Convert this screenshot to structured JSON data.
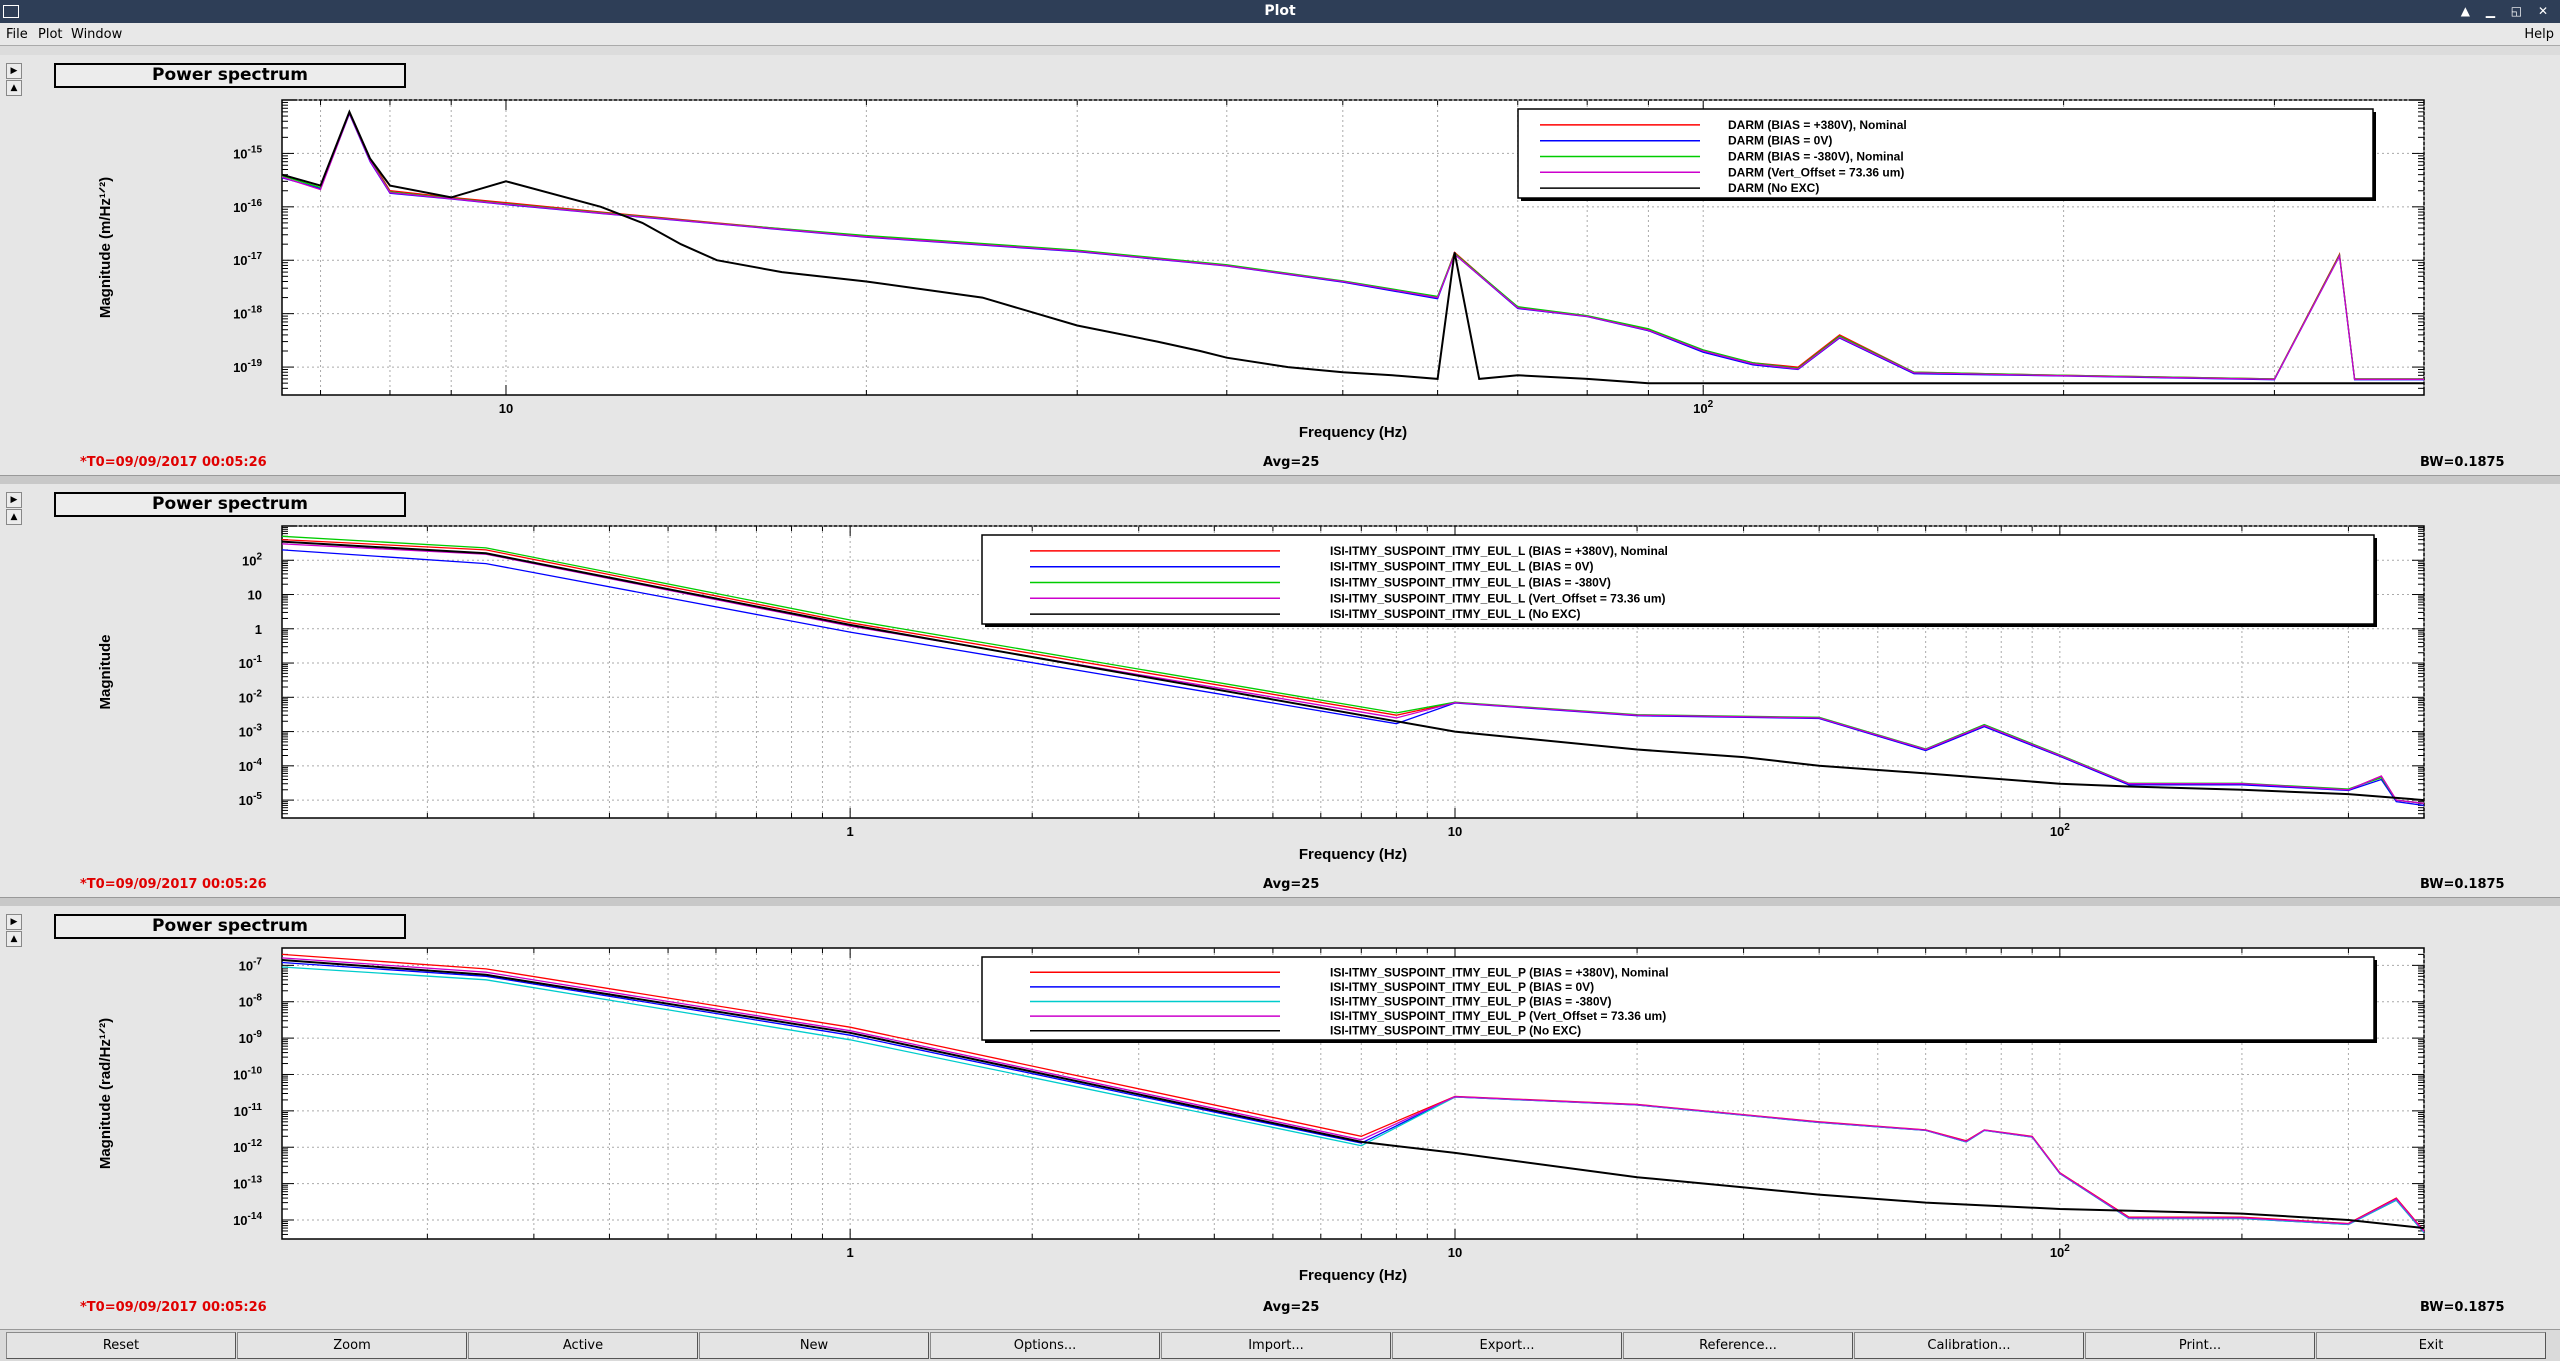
{
  "window": {
    "title": "Plot"
  },
  "menu": {
    "items": [
      "File",
      "Plot",
      "Window"
    ],
    "help": "Help"
  },
  "panels": [
    {
      "title": "Power spectrum",
      "t0": "*T0=09/09/2017 00:05:26",
      "avg": "Avg=25",
      "bw": "BW=0.1875"
    },
    {
      "title": "Power spectrum",
      "t0": "*T0=09/09/2017 00:05:26",
      "avg": "Avg=25",
      "bw": "BW=0.1875"
    },
    {
      "title": "Power spectrum",
      "t0": "*T0=09/09/2017 00:05:26",
      "avg": "Avg=25",
      "bw": "BW=0.1875"
    }
  ],
  "toolbar": {
    "buttons": [
      "Reset",
      "Zoom",
      "Active",
      "New",
      "Options...",
      "Import...",
      "Export...",
      "Reference...",
      "Calibration...",
      "Print...",
      "Exit"
    ]
  },
  "chart_data": [
    {
      "type": "line",
      "log_x": true,
      "log_y": true,
      "xlabel": "Frequency (Hz)",
      "ylabel": "Magnitude (m/Hz^1/2)",
      "xlim": [
        6.5,
        400
      ],
      "ylim": [
        3e-20,
        1e-14
      ],
      "xticks": [
        {
          "v": 10,
          "t": "10"
        },
        {
          "v": 100,
          "t": "10^2"
        }
      ],
      "yticks": [
        {
          "v": 1e-19,
          "t": "10^-19"
        },
        {
          "v": 1e-18,
          "t": "10^-18"
        },
        {
          "v": 1e-17,
          "t": "10^-17"
        },
        {
          "v": 1e-16,
          "t": "10^-16"
        },
        {
          "v": 1e-15,
          "t": "10^-15"
        }
      ],
      "legend_position": "top-right",
      "series": [
        {
          "name": "DARM (BIAS = +380V), Nominal",
          "color": "#ff0000",
          "x": [
            6.5,
            7,
            7.4,
            7.7,
            8,
            9,
            10,
            12,
            15,
            20,
            30,
            40,
            50,
            60,
            62,
            70,
            80,
            90,
            100,
            110,
            120,
            130,
            150,
            200,
            300,
            340,
            350,
            360,
            400
          ],
          "y": [
            4e-16,
            2.5e-16,
            6e-15,
            8e-16,
            2e-16,
            1.5e-16,
            1.2e-16,
            8e-17,
            5e-17,
            2.8e-17,
            1.5e-17,
            8e-18,
            4e-18,
            2e-18,
            1.4e-17,
            1.3e-18,
            9e-19,
            5e-19,
            2e-19,
            1.2e-19,
            1e-19,
            4e-19,
            8e-20,
            7e-20,
            6e-20,
            1.3e-17,
            6e-20,
            6e-20,
            6e-20
          ]
        },
        {
          "name": "DARM (BIAS = 0V)",
          "color": "#0000ff",
          "x": [
            6.5,
            7,
            7.4,
            7.7,
            8,
            9,
            10,
            12,
            15,
            20,
            30,
            40,
            50,
            60,
            62,
            70,
            80,
            90,
            100,
            110,
            120,
            130,
            150,
            200,
            300,
            340,
            350,
            360,
            400
          ],
          "y": [
            3.5e-16,
            2.2e-16,
            5.5e-15,
            7e-16,
            1.8e-16,
            1.4e-16,
            1.1e-16,
            7.5e-17,
            4.8e-17,
            2.7e-17,
            1.45e-17,
            7.8e-18,
            3.9e-18,
            1.9e-18,
            1.3e-17,
            1.25e-18,
            8.8e-19,
            4.8e-19,
            1.9e-19,
            1.1e-19,
            9e-20,
            3.5e-19,
            7.5e-20,
            6.8e-20,
            5.8e-20,
            1.2e-17,
            5.8e-20,
            5.8e-20,
            5.8e-20
          ]
        },
        {
          "name": "DARM (BIAS = -380V), Nominal",
          "color": "#00cc00",
          "x": [
            6.5,
            7,
            7.4,
            7.7,
            8,
            9,
            10,
            12,
            15,
            20,
            30,
            40,
            50,
            60,
            62,
            70,
            80,
            90,
            100,
            110,
            120,
            130,
            150,
            200,
            300,
            340,
            350,
            360,
            400
          ],
          "y": [
            3.8e-16,
            2.3e-16,
            5.8e-15,
            7.5e-16,
            1.9e-16,
            1.45e-16,
            1.15e-16,
            7.8e-17,
            4.9e-17,
            2.9e-17,
            1.55e-17,
            8.2e-18,
            4.1e-18,
            2.1e-18,
            1.35e-17,
            1.35e-18,
            9.2e-19,
            5.2e-19,
            2.1e-19,
            1.2e-19,
            9.5e-20,
            3.8e-19,
            8e-20,
            7e-20,
            6e-20,
            1.25e-17,
            6e-20,
            6e-20,
            6e-20
          ]
        },
        {
          "name": "DARM (Vert_Offset = 73.36 um)",
          "color": "#cc00cc",
          "x": [
            6.5,
            7,
            7.4,
            7.7,
            8,
            9,
            10,
            12,
            15,
            20,
            30,
            40,
            50,
            60,
            62,
            70,
            80,
            90,
            100,
            110,
            120,
            130,
            150,
            200,
            300,
            340,
            350,
            360,
            400
          ],
          "y": [
            3.6e-16,
            2.1e-16,
            5.6e-15,
            7.2e-16,
            1.85e-16,
            1.42e-16,
            1.12e-16,
            7.6e-17,
            4.85e-17,
            2.75e-17,
            1.48e-17,
            7.9e-18,
            4e-18,
            2e-18,
            1.3e-17,
            1.28e-18,
            8.9e-19,
            4.9e-19,
            2e-19,
            1.15e-19,
            9.2e-20,
            3.6e-19,
            7.8e-20,
            6.9e-20,
            5.9e-20,
            1.2e-17,
            5.9e-20,
            5.9e-20,
            5.9e-20
          ]
        },
        {
          "name": "DARM (No EXC)",
          "color": "#000000",
          "x": [
            6.5,
            7,
            7.4,
            7.7,
            8,
            9,
            10,
            12,
            13,
            14,
            15,
            17,
            20,
            25,
            30,
            35,
            38,
            40,
            45,
            50,
            55,
            60,
            62,
            65,
            70,
            80,
            90,
            100,
            150,
            200,
            300,
            400
          ],
          "y": [
            4e-16,
            2.5e-16,
            6e-15,
            8e-16,
            2.5e-16,
            1.5e-16,
            3e-16,
            1e-16,
            5e-17,
            2e-17,
            1e-17,
            6e-18,
            4e-18,
            2e-18,
            6e-19,
            3e-19,
            2e-19,
            1.5e-19,
            1e-19,
            8e-20,
            7e-20,
            6e-20,
            1.4e-17,
            6e-20,
            7e-20,
            6e-20,
            5e-20,
            5e-20,
            5e-20,
            5e-20,
            5e-20,
            5e-20
          ]
        }
      ]
    },
    {
      "type": "line",
      "log_x": true,
      "log_y": true,
      "xlabel": "Frequency (Hz)",
      "ylabel": "Magnitude",
      "xlim": [
        0.115,
        400
      ],
      "ylim": [
        3e-06,
        1000
      ],
      "xticks": [
        {
          "v": 1,
          "t": "1"
        },
        {
          "v": 10,
          "t": "10"
        },
        {
          "v": 100,
          "t": "10^2"
        }
      ],
      "yticks": [
        {
          "v": 1e-05,
          "t": "10^-5"
        },
        {
          "v": 0.0001,
          "t": "10^-4"
        },
        {
          "v": 0.001,
          "t": "10^-3"
        },
        {
          "v": 0.01,
          "t": "10^-2"
        },
        {
          "v": 0.1,
          "t": "10^-1"
        },
        {
          "v": 1,
          "t": "1"
        },
        {
          "v": 10,
          "t": "10"
        },
        {
          "v": 100,
          "t": "10^2"
        }
      ],
      "legend_position": "top-right",
      "series": [
        {
          "name": "ISI-ITMY_SUSPOINT_ITMY_EUL_L (BIAS = +380V), Nominal",
          "color": "#ff0000",
          "x": [
            0.115,
            0.25,
            1,
            8,
            10,
            20,
            40,
            60,
            75,
            100,
            130,
            200,
            300,
            340,
            360,
            400
          ],
          "y": [
            400,
            200,
            1.5,
            0.003,
            0.007,
            0.003,
            0.0025,
            0.0003,
            0.0015,
            0.0002,
            3e-05,
            3e-05,
            2e-05,
            5e-05,
            1e-05,
            8e-06
          ]
        },
        {
          "name": "ISI-ITMY_SUSPOINT_ITMY_EUL_L (BIAS = 0V)",
          "color": "#0000ff",
          "x": [
            0.115,
            0.25,
            1,
            8,
            10,
            20,
            40,
            60,
            75,
            100,
            130,
            200,
            300,
            340,
            360,
            400
          ],
          "y": [
            200,
            80,
            0.8,
            0.0017,
            0.0068,
            0.0029,
            0.0024,
            0.00028,
            0.0014,
            0.00019,
            2.8e-05,
            2.8e-05,
            1.9e-05,
            4e-05,
            9e-06,
            7e-06
          ]
        },
        {
          "name": "ISI-ITMY_SUSPOINT_ITMY_EUL_L (BIAS = -380V)",
          "color": "#00cc00",
          "x": [
            0.115,
            0.25,
            1,
            8,
            10,
            20,
            40,
            60,
            75,
            100,
            130,
            200,
            300,
            340,
            360,
            400
          ],
          "y": [
            500,
            230,
            1.8,
            0.0035,
            0.0072,
            0.0031,
            0.0026,
            0.00031,
            0.0016,
            0.00021,
            3.1e-05,
            3.1e-05,
            2.1e-05,
            4.5e-05,
            1e-05,
            8e-06
          ]
        },
        {
          "name": "ISI-ITMY_SUSPOINT_ITMY_EUL_L (Vert_Offset = 73.36 um)",
          "color": "#cc00cc",
          "x": [
            0.115,
            0.25,
            1,
            8,
            10,
            20,
            40,
            60,
            75,
            100,
            130,
            200,
            300,
            340,
            360,
            400
          ],
          "y": [
            300,
            150,
            1.2,
            0.0025,
            0.007,
            0.003,
            0.0025,
            0.0003,
            0.0015,
            0.0002,
            3e-05,
            3e-05,
            2e-05,
            5e-05,
            1e-05,
            8e-06
          ]
        },
        {
          "name": "ISI-ITMY_SUSPOINT_ITMY_EUL_L (No EXC)",
          "color": "#000000",
          "x": [
            0.115,
            0.25,
            1,
            8,
            10,
            20,
            30,
            40,
            60,
            100,
            130,
            200,
            300,
            400
          ],
          "y": [
            350,
            160,
            1.3,
            0.002,
            0.001,
            0.0003,
            0.00018,
            0.0001,
            6e-05,
            3e-05,
            2.5e-05,
            2e-05,
            1.5e-05,
            1e-05
          ]
        }
      ]
    },
    {
      "type": "line",
      "log_x": true,
      "log_y": true,
      "xlabel": "Frequency (Hz)",
      "ylabel": "Magnitude (rad/Hz^1/2)",
      "xlim": [
        0.115,
        400
      ],
      "ylim": [
        3e-15,
        3e-07
      ],
      "xticks": [
        {
          "v": 1,
          "t": "1"
        },
        {
          "v": 10,
          "t": "10"
        },
        {
          "v": 100,
          "t": "10^2"
        }
      ],
      "yticks": [
        {
          "v": 1e-14,
          "t": "10^-14"
        },
        {
          "v": 1e-13,
          "t": "10^-13"
        },
        {
          "v": 1e-12,
          "t": "10^-12"
        },
        {
          "v": 1e-11,
          "t": "10^-11"
        },
        {
          "v": 1e-10,
          "t": "10^-10"
        },
        {
          "v": 1e-09,
          "t": "10^-9"
        },
        {
          "v": 1e-08,
          "t": "10^-8"
        },
        {
          "v": 1e-07,
          "t": "10^-7"
        }
      ],
      "legend_position": "top-right",
      "series": [
        {
          "name": "ISI-ITMY_SUSPOINT_ITMY_EUL_P (BIAS = +380V), Nominal",
          "color": "#ff0000",
          "x": [
            0.115,
            0.25,
            1,
            7,
            10,
            20,
            40,
            60,
            70,
            75,
            90,
            100,
            130,
            200,
            300,
            360,
            400
          ],
          "y": [
            2e-07,
            8e-08,
            2e-09,
            2e-12,
            2.5e-11,
            1.5e-11,
            5e-12,
            3e-12,
            1.5e-12,
            3e-12,
            2e-12,
            2e-13,
            1.2e-14,
            1.2e-14,
            8e-15,
            4e-14,
            5e-15
          ]
        },
        {
          "name": "ISI-ITMY_SUSPOINT_ITMY_EUL_P (BIAS = 0V)",
          "color": "#0000ff",
          "x": [
            0.115,
            0.25,
            1,
            7,
            10,
            20,
            40,
            60,
            70,
            75,
            90,
            100,
            130,
            200,
            300,
            360,
            400
          ],
          "y": [
            1.2e-07,
            5e-08,
            1.2e-09,
            1.3e-12,
            2.4e-11,
            1.45e-11,
            4.8e-12,
            2.9e-12,
            1.4e-12,
            2.9e-12,
            1.9e-12,
            1.9e-13,
            1.1e-14,
            1.1e-14,
            7.5e-15,
            3.5e-14,
            4.5e-15
          ]
        },
        {
          "name": "ISI-ITMY_SUSPOINT_ITMY_EUL_P (BIAS = -380V)",
          "color": "#00cccc",
          "x": [
            0.115,
            0.25,
            1,
            7,
            10,
            20,
            40,
            60,
            70,
            75,
            90,
            100,
            130,
            200,
            300,
            360,
            400
          ],
          "y": [
            9e-08,
            4e-08,
            9e-10,
            1.1e-12,
            2.4e-11,
            1.45e-11,
            4.8e-12,
            2.9e-12,
            1.4e-12,
            2.9e-12,
            1.9e-12,
            1.9e-13,
            1.1e-14,
            1.1e-14,
            7.5e-15,
            3.5e-14,
            4.5e-15
          ]
        },
        {
          "name": "ISI-ITMY_SUSPOINT_ITMY_EUL_P (Vert_Offset = 73.36 um)",
          "color": "#cc00cc",
          "x": [
            0.115,
            0.25,
            1,
            7,
            10,
            20,
            40,
            60,
            70,
            75,
            90,
            100,
            130,
            200,
            300,
            360,
            400
          ],
          "y": [
            1.6e-07,
            6.5e-08,
            1.6e-09,
            1.6e-12,
            2.45e-11,
            1.48e-11,
            4.9e-12,
            2.95e-12,
            1.45e-12,
            2.95e-12,
            1.95e-12,
            1.95e-13,
            1.15e-14,
            1.15e-14,
            7.8e-15,
            3.8e-14,
            4.8e-15
          ]
        },
        {
          "name": "ISI-ITMY_SUSPOINT_ITMY_EUL_P (No EXC)",
          "color": "#000000",
          "x": [
            0.115,
            0.25,
            1,
            7,
            10,
            20,
            40,
            60,
            100,
            200,
            300,
            400
          ],
          "y": [
            1.4e-07,
            5.5e-08,
            1.4e-09,
            1.4e-12,
            7e-13,
            1.5e-13,
            5e-14,
            3e-14,
            2e-14,
            1.5e-14,
            1e-14,
            6e-15
          ]
        }
      ]
    }
  ]
}
